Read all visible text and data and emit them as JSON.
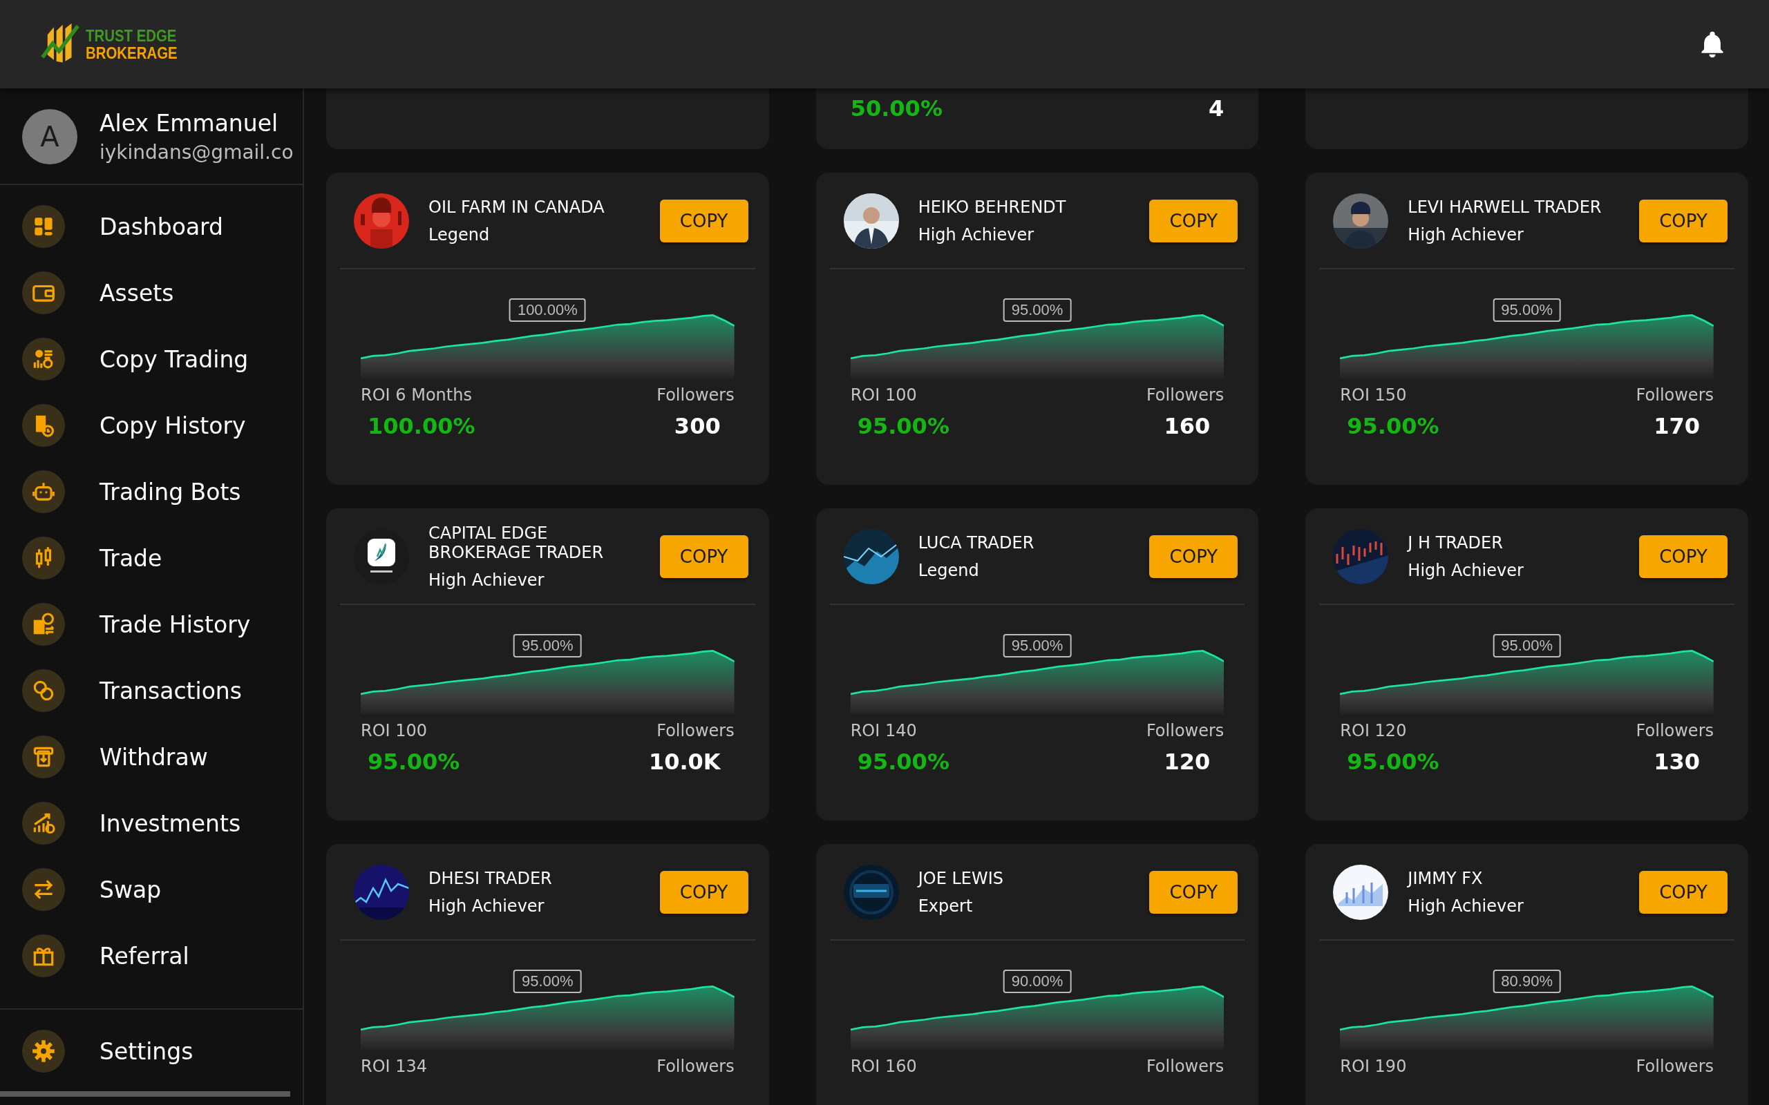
{
  "header": {
    "logo": {
      "line1": "TRUST EDGE",
      "line2": "BROKERAGE"
    }
  },
  "user": {
    "initial": "A",
    "name": "Alex Emmanuel",
    "email": "iykindans@gmail.co"
  },
  "sidebar": {
    "items": [
      {
        "label": "Dashboard"
      },
      {
        "label": "Assets"
      },
      {
        "label": "Copy Trading"
      },
      {
        "label": "Copy History"
      },
      {
        "label": "Trading Bots"
      },
      {
        "label": "Trade"
      },
      {
        "label": "Trade History"
      },
      {
        "label": "Transactions"
      },
      {
        "label": "Withdraw"
      },
      {
        "label": "Investments"
      },
      {
        "label": "Swap"
      },
      {
        "label": "Referral"
      }
    ],
    "footer_item": {
      "label": "Settings"
    }
  },
  "partial_cards": [
    {
      "kind": "blank"
    },
    {
      "kind": "stats",
      "roi_value": "50.00%",
      "followers_value": "4"
    },
    {
      "kind": "blank"
    }
  ],
  "traders": [
    {
      "name": "OIL FARM IN CANADA",
      "tier": "Legend",
      "button": "COPY",
      "chart_label": "100.00%",
      "roi_label": "ROI 6 Months",
      "roi_value": "100.00%",
      "followers_label": "Followers",
      "followers_value": "300"
    },
    {
      "name": "HEIKO BEHRENDT",
      "tier": "High Achiever",
      "button": "COPY",
      "chart_label": "95.00%",
      "roi_label": "ROI 100",
      "roi_value": "95.00%",
      "followers_label": "Followers",
      "followers_value": "160"
    },
    {
      "name": "LEVI HARWELL TRADER",
      "tier": "High Achiever",
      "button": "COPY",
      "chart_label": "95.00%",
      "roi_label": "ROI 150",
      "roi_value": "95.00%",
      "followers_label": "Followers",
      "followers_value": "170"
    },
    {
      "name": "CAPITAL EDGE BROKERAGE TRADER",
      "tier": "High Achiever",
      "button": "COPY",
      "chart_label": "95.00%",
      "roi_label": "ROI 100",
      "roi_value": "95.00%",
      "followers_label": "Followers",
      "followers_value": "10.0K"
    },
    {
      "name": "LUCA TRADER",
      "tier": "Legend",
      "button": "COPY",
      "chart_label": "95.00%",
      "roi_label": "ROI 140",
      "roi_value": "95.00%",
      "followers_label": "Followers",
      "followers_value": "120"
    },
    {
      "name": "J H TRADER",
      "tier": "High Achiever",
      "button": "COPY",
      "chart_label": "95.00%",
      "roi_label": "ROI 120",
      "roi_value": "95.00%",
      "followers_label": "Followers",
      "followers_value": "130"
    },
    {
      "name": "DHESI TRADER",
      "tier": "High Achiever",
      "button": "COPY",
      "chart_label": "95.00%",
      "roi_label": "ROI 134",
      "followers_label": "Followers"
    },
    {
      "name": "JOE LEWIS",
      "tier": "Expert",
      "button": "COPY",
      "chart_label": "90.00%",
      "roi_label": "ROI 160",
      "followers_label": "Followers"
    },
    {
      "name": "JIMMY FX",
      "tier": "High Achiever",
      "button": "COPY",
      "chart_label": "80.90%",
      "roi_label": "ROI 190",
      "followers_label": "Followers"
    }
  ]
}
